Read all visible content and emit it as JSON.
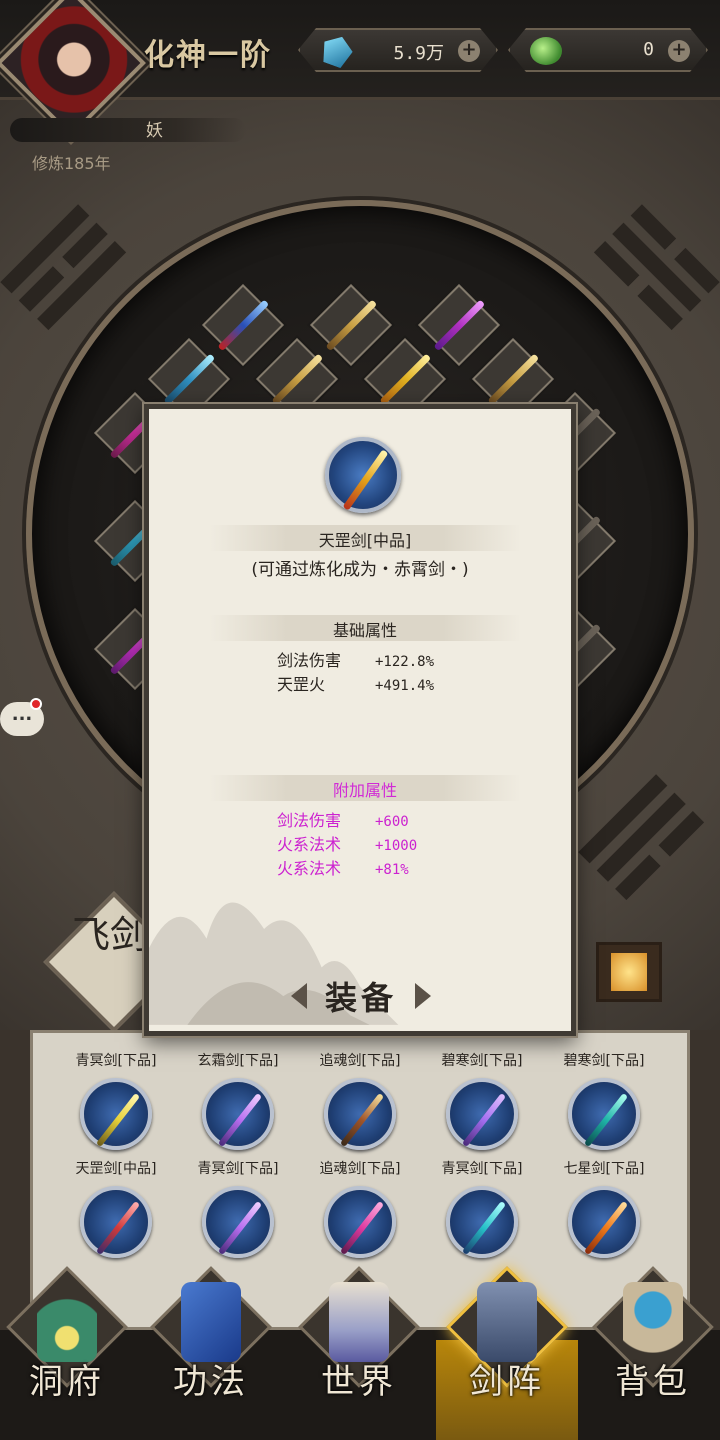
{
  "header": {
    "rank": "化神一阶",
    "resources": [
      {
        "icon": "spirit-stone-icon",
        "value": "5.9万",
        "plus": "+"
      },
      {
        "icon": "jade-coin-icon",
        "value": "0",
        "plus": "+"
      }
    ],
    "name": "妖",
    "cultivation": "修炼185年"
  },
  "chat": {
    "label": "..."
  },
  "fly_sign": "飞剑",
  "popup": {
    "item_name": "天罡剑[中品]",
    "refine_hint": "(可通过炼化成为・赤霄剑・)",
    "base_title": "基础属性",
    "base_attrs": [
      {
        "name": "剑法伤害",
        "value": "+122.8%"
      },
      {
        "name": "天罡火",
        "value": "+491.4%"
      }
    ],
    "extra_title": "附加属性",
    "extra_attrs": [
      {
        "name": "剑法伤害",
        "value": "+600"
      },
      {
        "name": "火系法术",
        "value": "+1000"
      },
      {
        "name": "火系法术",
        "value": "+81%"
      }
    ],
    "equip_button": "装备"
  },
  "inventory": [
    {
      "label": "青冥剑[下品]",
      "color": "#e8d23a"
    },
    {
      "label": "玄霜剑[下品]",
      "color": "#b86ef0"
    },
    {
      "label": "追魂剑[下品]",
      "color": "#a0552a"
    },
    {
      "label": "碧寒剑[下品]",
      "color": "#a46ef0"
    },
    {
      "label": "碧寒剑[下品]",
      "color": "#1fb5a8"
    },
    {
      "label": "天罡剑[中品]",
      "color": "#d23a3a"
    },
    {
      "label": "青冥剑[下品]",
      "color": "#b86ef0"
    },
    {
      "label": "追魂剑[下品]",
      "color": "#e03aa0"
    },
    {
      "label": "青冥剑[下品]",
      "color": "#26c2c8"
    },
    {
      "label": "七星剑[下品]",
      "color": "#f07a1a"
    }
  ],
  "nav": [
    {
      "label": "洞府",
      "icon": "cave-dwelling-icon"
    },
    {
      "label": "功法",
      "icon": "technique-book-icon"
    },
    {
      "label": "世界",
      "icon": "world-scroll-icon"
    },
    {
      "label": "剑阵",
      "icon": "sword-array-icon",
      "active": true
    },
    {
      "label": "背包",
      "icon": "backpack-icon"
    }
  ]
}
